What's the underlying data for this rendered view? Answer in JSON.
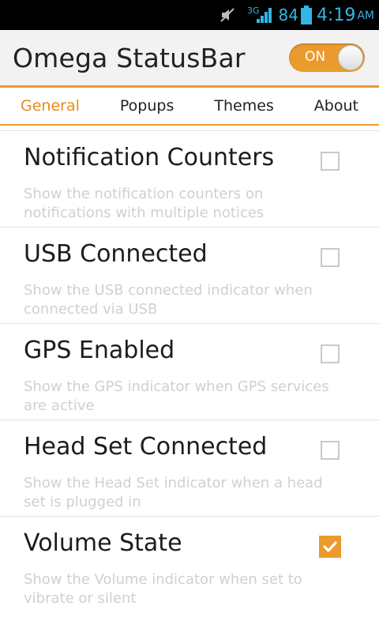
{
  "status_bar": {
    "network_type": "3G",
    "battery_percent": "84",
    "time": "4:19",
    "ampm": "AM",
    "icons": [
      "mute-icon",
      "signal-icon",
      "battery-icon"
    ]
  },
  "header": {
    "title": "Omega StatusBar",
    "toggle_label": "ON"
  },
  "colors": {
    "accent": "#eb9a2e",
    "status_text": "#33b5e5",
    "description_text": "#d0d0d0"
  },
  "tabs": [
    {
      "label": "General",
      "active": true
    },
    {
      "label": "Popups",
      "active": false
    },
    {
      "label": "Themes",
      "active": false
    },
    {
      "label": "About",
      "active": false
    }
  ],
  "settings": [
    {
      "title": "Notification Counters",
      "description": "Show the notification counters on notifications with multiple notices",
      "checked": false
    },
    {
      "title": "USB Connected",
      "description": "Show the USB connected indicator when connected via USB",
      "checked": false
    },
    {
      "title": "GPS Enabled",
      "description": "Show the GPS indicator when GPS services are active",
      "checked": false
    },
    {
      "title": "Head Set Connected",
      "description": "Show the Head Set indicator when a head set is plugged in",
      "checked": false
    },
    {
      "title": "Volume State",
      "description": "Show the Volume indicator when set to vibrate or silent",
      "checked": true
    }
  ]
}
